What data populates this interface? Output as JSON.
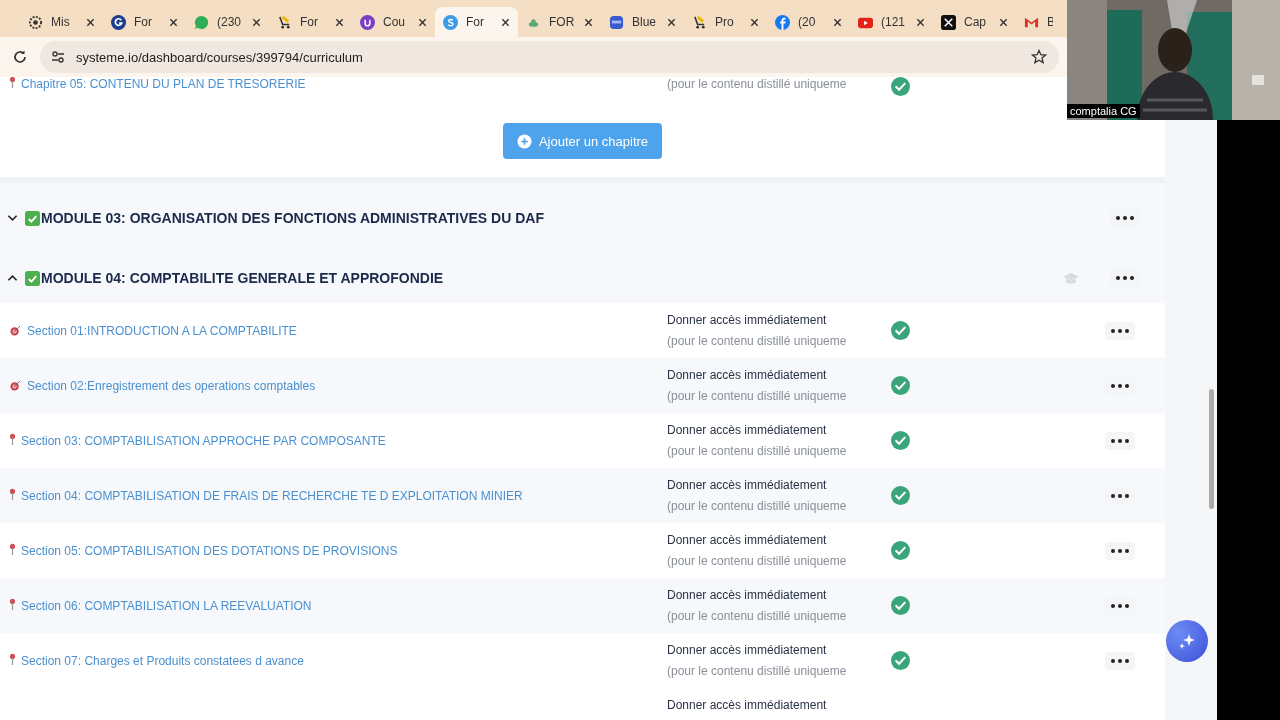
{
  "browser": {
    "tabs": [
      {
        "label": "Mis",
        "selected": false
      },
      {
        "label": "For",
        "selected": false
      },
      {
        "label": "(230",
        "selected": false
      },
      {
        "label": "For",
        "selected": false
      },
      {
        "label": "Cou",
        "selected": false
      },
      {
        "label": "For",
        "selected": true
      },
      {
        "label": "FOR",
        "selected": false
      },
      {
        "label": "Blue",
        "selected": false
      },
      {
        "label": "Pro",
        "selected": false
      },
      {
        "label": "(20",
        "selected": false
      },
      {
        "label": "(121",
        "selected": false
      },
      {
        "label": "Cap",
        "selected": false
      },
      {
        "label": "B",
        "selected": false
      }
    ],
    "address": "systeme.io/dashboard/courses/399794/curriculum"
  },
  "chapter_above": {
    "title": "Chapitre 05: CONTENU DU PLAN DE TRESORERIE",
    "note": "(pour le contenu distillé uniqueme",
    "published": true
  },
  "add_chapter_button": "Ajouter un chapitre",
  "modules": [
    {
      "title": "MODULE 03: ORGANISATION DES FONCTIONS ADMINISTRATIVES DU DAF",
      "expanded": false
    },
    {
      "title": "MODULE 04: COMPTABILITE GENERALE ET APPROFONDIE",
      "expanded": true,
      "sections": [
        {
          "kind": "dart",
          "title": "Section 01:INTRODUCTION A LA COMPTABILITE",
          "access": "Donner accès immédiatement",
          "note": "(pour le contenu distillé uniqueme",
          "published": true
        },
        {
          "kind": "dart",
          "title": "Section 02:Enregistrement des operations comptables",
          "access": "Donner accès immédiatement",
          "note": "(pour le contenu distillé uniqueme",
          "published": true
        },
        {
          "kind": "pin",
          "title": "Section 03: COMPTABILISATION APPROCHE PAR COMPOSANTE",
          "access": "Donner accès immédiatement",
          "note": "(pour le contenu distillé uniqueme",
          "published": true
        },
        {
          "kind": "pin",
          "title": "Section 04: COMPTABILISATION DE FRAIS DE RECHERCHE TE D EXPLOITATION MINIER",
          "access": "Donner accès immédiatement",
          "note": "(pour le contenu distillé uniqueme",
          "published": true
        },
        {
          "kind": "pin",
          "title": "Section 05: COMPTABILISATION DES DOTATIONS DE PROVISIONS",
          "access": "Donner accès immédiatement",
          "note": "(pour le contenu distillé uniqueme",
          "published": true
        },
        {
          "kind": "pin",
          "title": "Section 06: COMPTABILISATION LA REEVALUATION",
          "access": "Donner accès immédiatement",
          "note": "(pour le contenu distillé uniqueme",
          "published": true
        },
        {
          "kind": "pin",
          "title": "Section 07: Charges et Produits constatees d avance",
          "access": "Donner accès immédiatement",
          "note": "(pour le contenu distillé uniqueme",
          "published": true
        }
      ],
      "next_access": "Donner accès immédiatement"
    }
  ],
  "video_call": {
    "kind": "picture",
    "name": "comptalia CG"
  }
}
